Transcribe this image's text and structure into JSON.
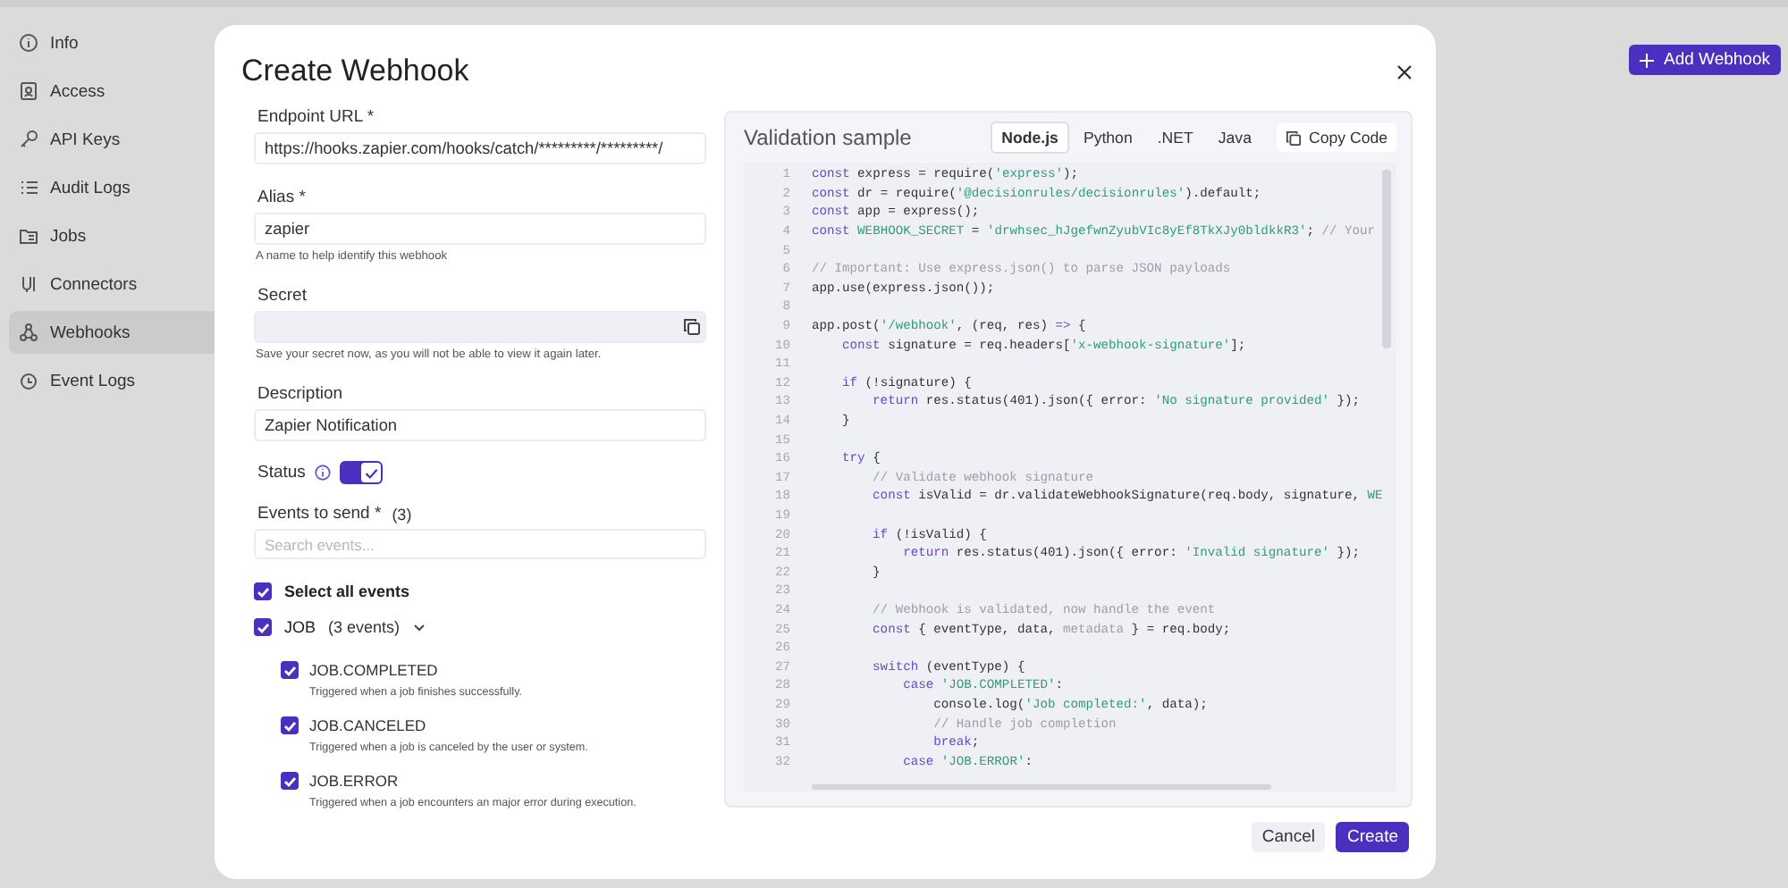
{
  "sidebar": {
    "items": [
      {
        "label": "Info",
        "selected": false
      },
      {
        "label": "Access",
        "selected": false
      },
      {
        "label": "API Keys",
        "selected": false
      },
      {
        "label": "Audit Logs",
        "selected": false
      },
      {
        "label": "Jobs",
        "selected": false
      },
      {
        "label": "Connectors",
        "selected": false
      },
      {
        "label": "Webhooks",
        "selected": true
      },
      {
        "label": "Event Logs",
        "selected": false
      }
    ]
  },
  "header": {
    "add_button": "Add Webhook"
  },
  "dialog": {
    "title": "Create Webhook",
    "endpoint": {
      "label": "Endpoint URL *",
      "value": "https://hooks.zapier.com/hooks/catch/*********/*********/"
    },
    "alias": {
      "label": "Alias *",
      "value": "zapier",
      "help": "A name to help identify this webhook"
    },
    "secret": {
      "label": "Secret",
      "help": "Save your secret now, as you will not be able to view it again later."
    },
    "description": {
      "label": "Description",
      "value": "Zapier Notification"
    },
    "status": {
      "label": "Status",
      "on": true
    },
    "events": {
      "label": "Events to send *",
      "count": "(3)",
      "placeholder": "Search events..."
    },
    "select_all": {
      "label": "Select all events",
      "checked": true
    },
    "groups": [
      {
        "label": "JOB",
        "count": "(3 events)",
        "checked": true,
        "expanded": true,
        "children": [
          {
            "label": "JOB.COMPLETED",
            "description": "Triggered when a job finishes successfully.",
            "checked": true
          },
          {
            "label": "JOB.CANCELED",
            "description": "Triggered when a job is canceled by the user or system.",
            "checked": true
          },
          {
            "label": "JOB.ERROR",
            "description": "Triggered when a job encounters an major error during execution.",
            "checked": true
          }
        ]
      }
    ],
    "sample": {
      "title": "Validation sample",
      "copy": "Copy Code",
      "tabs": [
        {
          "label": "Node.js",
          "selected": true
        },
        {
          "label": "Python",
          "selected": false
        },
        {
          "label": ".NET",
          "selected": false
        },
        {
          "label": "Java",
          "selected": false
        }
      ],
      "lines": [
        {
          "n": "1",
          "code": [
            {
              "kind": "keyword",
              "text": "const"
            },
            {
              "kind": "plain",
              "text": " express = require("
            },
            {
              "kind": "string",
              "text": "'express'"
            },
            {
              "kind": "plain",
              "text": ");"
            }
          ]
        },
        {
          "n": "2",
          "code": [
            {
              "kind": "keyword",
              "text": "const"
            },
            {
              "kind": "plain",
              "text": " dr = require("
            },
            {
              "kind": "string",
              "text": "'@decisionrules/decisionrules'"
            },
            {
              "kind": "plain",
              "text": ").default;"
            }
          ]
        },
        {
          "n": "3",
          "code": [
            {
              "kind": "keyword",
              "text": "const"
            },
            {
              "kind": "plain",
              "text": " app = express();"
            }
          ]
        },
        {
          "n": "4",
          "code": [
            {
              "kind": "keyword",
              "text": "const"
            },
            {
              "kind": "string",
              "text": " WEBHOOK_SECRET"
            },
            {
              "kind": "plain",
              "text": " = "
            },
            {
              "kind": "string",
              "text": "'drwhsec_hJgefwnZyubVIc8yEf8TkXJy0bldkkR3'"
            },
            {
              "kind": "plain",
              "text": "; "
            },
            {
              "kind": "comment",
              "text": "// Your"
            }
          ]
        },
        {
          "n": "5"
        },
        {
          "n": "6",
          "code": [
            {
              "kind": "comment",
              "text": "// Important: Use express.json() to parse JSON payloads"
            }
          ]
        },
        {
          "n": "7",
          "code": [
            {
              "kind": "plain",
              "text": "app.use(express.json());"
            }
          ]
        },
        {
          "n": "8"
        },
        {
          "n": "9",
          "code": [
            {
              "kind": "plain",
              "text": "app.post("
            },
            {
              "kind": "string",
              "text": "'/webhook'"
            },
            {
              "kind": "plain",
              "text": ", (req, res) "
            },
            {
              "kind": "keyword",
              "text": "=>"
            },
            {
              "kind": "plain",
              "text": " {"
            }
          ]
        },
        {
          "n": "10",
          "code": [
            {
              "kind": "keyword",
              "text": "    const"
            },
            {
              "kind": "plain",
              "text": " signature = req.headers["
            },
            {
              "kind": "string",
              "text": "'x-webhook-signature'"
            },
            {
              "kind": "plain",
              "text": "];"
            }
          ]
        },
        {
          "n": "11"
        },
        {
          "n": "12",
          "code": [
            {
              "kind": "keyword",
              "text": "    if"
            },
            {
              "kind": "plain",
              "text": " (!signature) {"
            }
          ]
        },
        {
          "n": "13",
          "code": [
            {
              "kind": "keyword",
              "text": "        return"
            },
            {
              "kind": "plain",
              "text": " res.status(401).json({ error: "
            },
            {
              "kind": "string",
              "text": "'No signature provided'"
            },
            {
              "kind": "plain",
              "text": " });"
            }
          ]
        },
        {
          "n": "14",
          "code": [
            {
              "kind": "plain",
              "text": "    }"
            }
          ]
        },
        {
          "n": "15"
        },
        {
          "n": "16",
          "code": [
            {
              "kind": "keyword",
              "text": "    try"
            },
            {
              "kind": "plain",
              "text": " {"
            }
          ]
        },
        {
          "n": "17",
          "code": [
            {
              "kind": "comment",
              "text": "        // Validate webhook signature"
            }
          ]
        },
        {
          "n": "18",
          "code": [
            {
              "kind": "keyword",
              "text": "        const"
            },
            {
              "kind": "plain",
              "text": " isValid = dr.validateWebhookSignature(req.body, signature, "
            },
            {
              "kind": "string",
              "text": "WE"
            }
          ]
        },
        {
          "n": "19"
        },
        {
          "n": "20",
          "code": [
            {
              "kind": "keyword",
              "text": "        if"
            },
            {
              "kind": "plain",
              "text": " (!isValid) {"
            }
          ]
        },
        {
          "n": "21",
          "code": [
            {
              "kind": "keyword",
              "text": "            return"
            },
            {
              "kind": "plain",
              "text": " res.status(401).json({ error: "
            },
            {
              "kind": "string",
              "text": "'Invalid signature'"
            },
            {
              "kind": "plain",
              "text": " });"
            }
          ]
        },
        {
          "n": "22",
          "code": [
            {
              "kind": "plain",
              "text": "        }"
            }
          ]
        },
        {
          "n": "23"
        },
        {
          "n": "24",
          "code": [
            {
              "kind": "comment",
              "text": "        // Webhook is validated, now handle the event"
            }
          ]
        },
        {
          "n": "25",
          "code": [
            {
              "kind": "keyword",
              "text": "        const"
            },
            {
              "kind": "plain",
              "text": " { eventType, data, "
            },
            {
              "kind": "comment",
              "text": "metadata"
            },
            {
              "kind": "plain",
              "text": " } = req.body;"
            }
          ]
        },
        {
          "n": "26"
        },
        {
          "n": "27",
          "code": [
            {
              "kind": "keyword",
              "text": "        switch"
            },
            {
              "kind": "plain",
              "text": " (eventType) {"
            }
          ]
        },
        {
          "n": "28",
          "code": [
            {
              "kind": "keyword",
              "text": "            case"
            },
            {
              "kind": "string",
              "text": " 'JOB.COMPLETED'"
            },
            {
              "kind": "plain",
              "text": ":"
            }
          ]
        },
        {
          "n": "29",
          "code": [
            {
              "kind": "plain",
              "text": "                console.log("
            },
            {
              "kind": "string",
              "text": "'Job completed:'"
            },
            {
              "kind": "plain",
              "text": ", data);"
            }
          ]
        },
        {
          "n": "30",
          "code": [
            {
              "kind": "comment",
              "text": "                // Handle job completion"
            }
          ]
        },
        {
          "n": "31",
          "code": [
            {
              "kind": "keyword",
              "text": "                break"
            },
            {
              "kind": "plain",
              "text": ";"
            }
          ]
        },
        {
          "n": "32",
          "code": [
            {
              "kind": "keyword",
              "text": "            case"
            },
            {
              "kind": "string",
              "text": " 'JOB.ERROR'"
            },
            {
              "kind": "plain",
              "text": ":"
            }
          ]
        }
      ]
    },
    "buttons": {
      "cancel": "Cancel",
      "create": "Create"
    }
  }
}
